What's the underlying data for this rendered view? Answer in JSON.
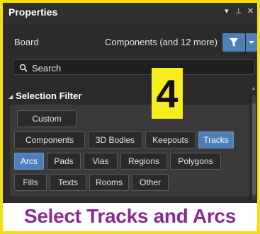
{
  "panel": {
    "title": "Properties",
    "controls": {
      "dropdown": "▾",
      "pin": "⊥",
      "close": "✕"
    }
  },
  "board": {
    "label": "Board",
    "components_label": "Components (and 12 more)"
  },
  "search": {
    "placeholder": "Search"
  },
  "selection_filter": {
    "header": "Selection Filter",
    "buttons": [
      {
        "label": "Custom",
        "active": false
      },
      {
        "label": "Components",
        "active": false
      },
      {
        "label": "3D Bodies",
        "active": false
      },
      {
        "label": "Keepouts",
        "active": false
      },
      {
        "label": "Tracks",
        "active": true
      },
      {
        "label": "Arcs",
        "active": true
      },
      {
        "label": "Pads",
        "active": false
      },
      {
        "label": "Vias",
        "active": false
      },
      {
        "label": "Regions",
        "active": false
      },
      {
        "label": "Polygons",
        "active": false
      },
      {
        "label": "Fills",
        "active": false
      },
      {
        "label": "Texts",
        "active": false
      },
      {
        "label": "Rooms",
        "active": false
      },
      {
        "label": "Other",
        "active": false
      }
    ]
  },
  "step_badge": "4",
  "caption": "Select Tracks and Arcs",
  "colors": {
    "frame": "#f4df0c",
    "panel_bg": "#2b2b2b",
    "accent": "#4f7fb8",
    "badge": "#f8ee1e",
    "caption": "#8a2a90"
  },
  "icons": {
    "filter": "funnel-icon",
    "search": "search-icon",
    "collapse": "triangle-down-icon"
  }
}
